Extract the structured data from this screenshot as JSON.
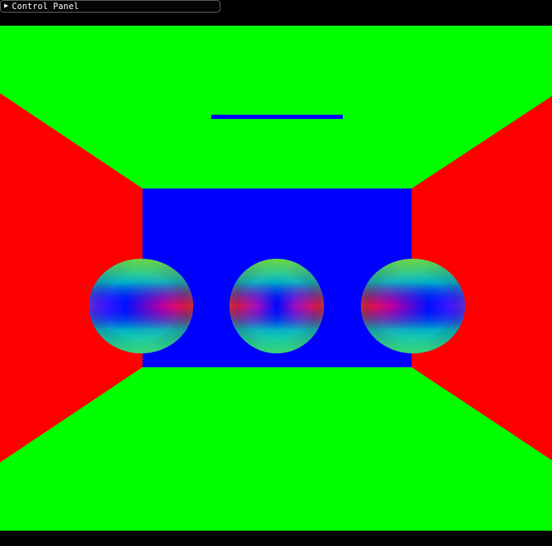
{
  "window": {
    "control_panel": {
      "title": "Control Panel",
      "collapsed": true,
      "arrow_icon": "triangle-right-icon"
    }
  },
  "scene": {
    "colors": {
      "ceiling": "#00ff00",
      "floor": "#00ff00",
      "left_wall": "#ff0000",
      "right_wall": "#ff0000",
      "back_wall": "#0000ff",
      "light": "#0000ff",
      "background": "#000000"
    },
    "spheres": [
      {
        "id": "left",
        "shading": "normal-map"
      },
      {
        "id": "center",
        "shading": "normal-map"
      },
      {
        "id": "right",
        "shading": "normal-map"
      }
    ]
  }
}
